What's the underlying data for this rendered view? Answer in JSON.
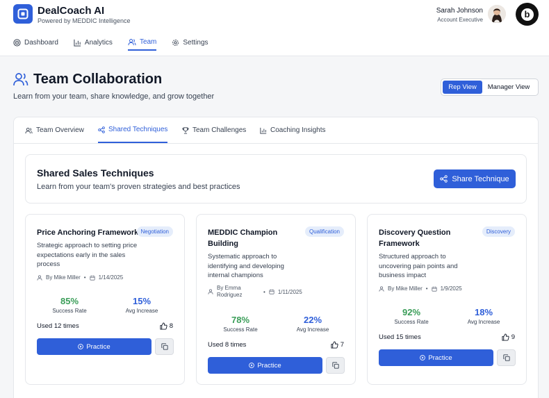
{
  "app": {
    "brand": "DealCoach AI",
    "subtitle": "Powered by MEDDIC Intelligence",
    "user_name": "Sarah Johnson",
    "user_role": "Account Executive",
    "badge_letter": "b"
  },
  "nav": {
    "items": [
      {
        "label": "Dashboard",
        "icon": "target-icon"
      },
      {
        "label": "Analytics",
        "icon": "bar-chart-icon"
      },
      {
        "label": "Team",
        "icon": "users-icon",
        "active": true
      },
      {
        "label": "Settings",
        "icon": "gear-icon"
      }
    ]
  },
  "page": {
    "title": "Team Collaboration",
    "subtitle": "Learn from your team, share knowledge, and grow together",
    "view_rep": "Rep View",
    "view_manager": "Manager View"
  },
  "tabs": [
    {
      "label": "Team Overview",
      "icon": "users-icon"
    },
    {
      "label": "Shared Techniques",
      "icon": "share-icon",
      "active": true
    },
    {
      "label": "Team Challenges",
      "icon": "trophy-icon"
    },
    {
      "label": "Coaching Insights",
      "icon": "bar-chart-icon"
    }
  ],
  "intro": {
    "title": "Shared Sales Techniques",
    "subtitle": "Learn from your team's proven strategies and best practices",
    "share_label": "Share Technique"
  },
  "cards": [
    {
      "title": "Price Anchoring Framework",
      "tag": "Negotiation",
      "description": "Strategic approach to setting price expectations early in the sales process",
      "author": "By Mike Miller",
      "date": "1/14/2025",
      "success_rate": "85%",
      "success_label": "Success Rate",
      "avg_increase": "15%",
      "avg_label": "Avg Increase",
      "used": "Used 12 times",
      "likes": "8",
      "practice_label": "Practice"
    },
    {
      "title": "MEDDIC Champion Building",
      "tag": "Qualification",
      "description": "Systematic approach to identifying and developing internal champions",
      "author": "By Emma Rodriguez",
      "date": "1/11/2025",
      "success_rate": "78%",
      "success_label": "Success Rate",
      "avg_increase": "22%",
      "avg_label": "Avg Increase",
      "used": "Used 8 times",
      "likes": "7",
      "practice_label": "Practice"
    },
    {
      "title": "Discovery Question Framework",
      "tag": "Discovery",
      "description": "Structured approach to uncovering pain points and business impact",
      "author": "By Mike Miller",
      "date": "1/9/2025",
      "success_rate": "92%",
      "success_label": "Success Rate",
      "avg_increase": "18%",
      "avg_label": "Avg Increase",
      "used": "Used 15 times",
      "likes": "9",
      "practice_label": "Practice"
    }
  ],
  "colors": {
    "accent": "#2f5fd9",
    "success": "#3a9d58",
    "tag_bg": "#e5edfb"
  }
}
